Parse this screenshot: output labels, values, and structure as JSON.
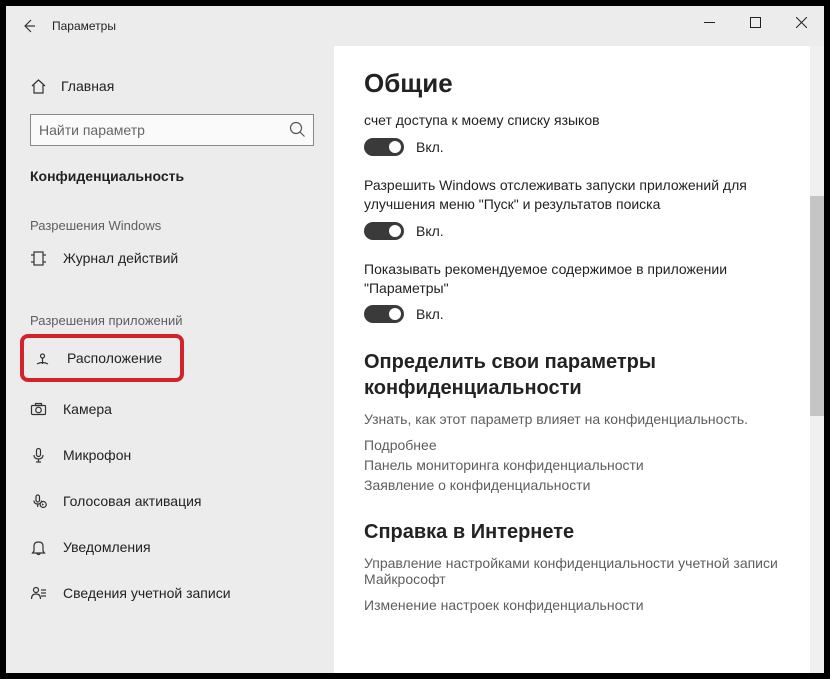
{
  "titlebar": {
    "title": "Параметры"
  },
  "sidebar": {
    "home": "Главная",
    "search_placeholder": "Найти параметр",
    "category": "Конфиденциальность",
    "section_windows": "Разрешения Windows",
    "section_apps": "Разрешения приложений",
    "items": {
      "activity": "Журнал действий",
      "location": "Расположение",
      "camera": "Камера",
      "microphone": "Микрофон",
      "voice": "Голосовая активация",
      "notifications": "Уведомления",
      "account": "Сведения учетной записи"
    }
  },
  "content": {
    "heading": "Общие",
    "s1": {
      "text": "счет доступа к моему списку языков",
      "state": "Вкл."
    },
    "s2": {
      "text": "Разрешить Windows отслеживать запуски приложений для улучшения меню \"Пуск\" и результатов поиска",
      "state": "Вкл."
    },
    "s3": {
      "text": "Показывать рекомендуемое содержимое в приложении \"Параметры\"",
      "state": "Вкл."
    },
    "priv_head": "Определить свои параметры конфиденциальности",
    "priv_sub": "Узнать, как этот параметр влияет на конфиденциальность.",
    "link1": "Подробнее",
    "link2": "Панель мониторинга конфиденциальности",
    "link3": "Заявление о конфиденциальности",
    "help_head": "Справка в Интернете",
    "help1": "Управление настройками конфиденциальности учетной записи Майкрософт",
    "help2": "Изменение настроек конфиденциальности"
  }
}
